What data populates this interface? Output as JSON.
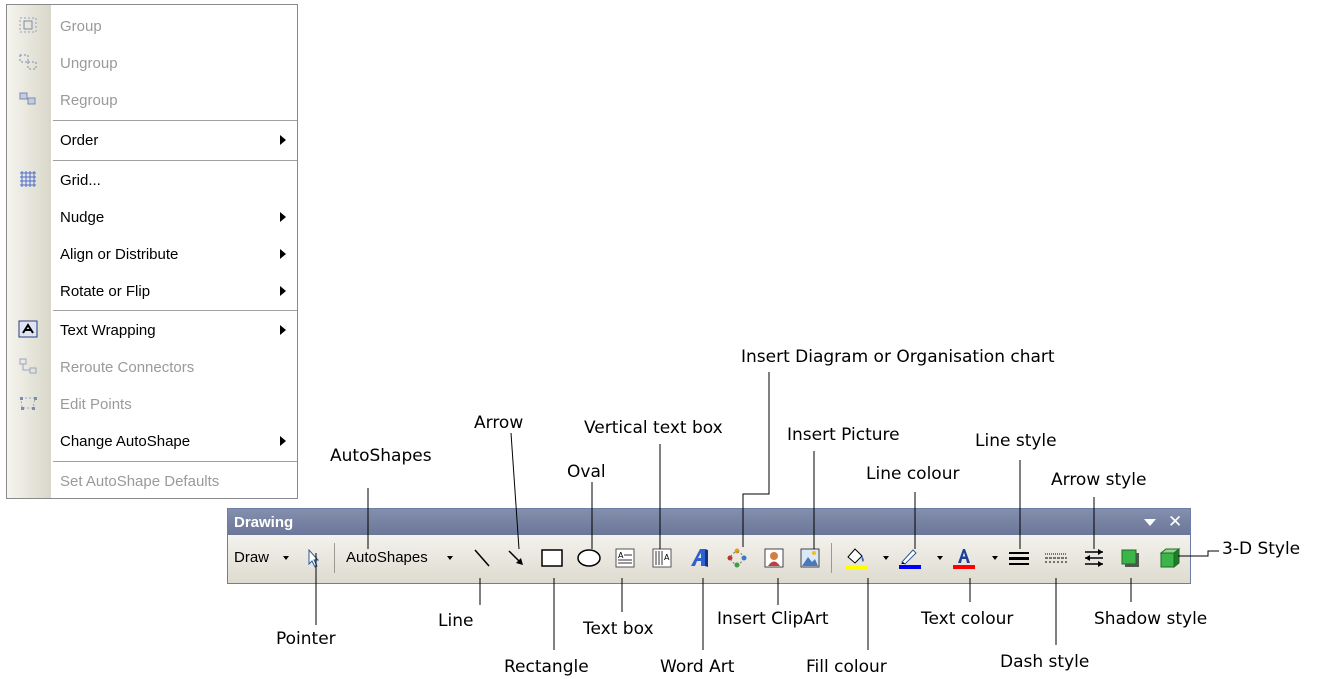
{
  "menu": {
    "items": [
      {
        "label": "Group",
        "disabled": true,
        "icon": "group-icon"
      },
      {
        "label": "Ungroup",
        "disabled": true,
        "icon": "ungroup-icon"
      },
      {
        "label": "Regroup",
        "disabled": true,
        "icon": "regroup-icon"
      },
      {
        "label": "Order",
        "submenu": true
      },
      {
        "label": "Grid...",
        "icon": "grid-icon"
      },
      {
        "label": "Nudge",
        "submenu": true
      },
      {
        "label": "Align or Distribute",
        "submenu": true
      },
      {
        "label": "Rotate or Flip",
        "submenu": true
      },
      {
        "label": "Text Wrapping",
        "submenu": true,
        "icon": "text-wrapping-icon"
      },
      {
        "label": "Reroute Connectors",
        "disabled": true,
        "icon": "reroute-connectors-icon"
      },
      {
        "label": "Edit Points",
        "disabled": true,
        "icon": "edit-points-icon"
      },
      {
        "label": "Change AutoShape",
        "submenu": true
      },
      {
        "label": "Set AutoShape Defaults",
        "disabled": true
      }
    ]
  },
  "toolbar": {
    "title": "Drawing",
    "draw_label": "Draw",
    "autoshapes_label": "AutoShapes",
    "fill_color": "#ffff00",
    "line_color": "#0000ff",
    "text_color": "#ff0000"
  },
  "callouts": {
    "pointer": "Pointer",
    "autoshapes": "AutoShapes",
    "line": "Line",
    "arrow": "Arrow",
    "rectangle": "Rectangle",
    "oval": "Oval",
    "text_box": "Text box",
    "vertical_text_box": "Vertical text box",
    "word_art": "Word Art",
    "insert_diagram": "Insert Diagram or Organisation chart",
    "insert_clipart": "Insert ClipArt",
    "insert_picture": "Insert Picture",
    "fill_colour": "Fill colour",
    "line_colour": "Line colour",
    "text_colour": "Text colour",
    "line_style": "Line style",
    "dash_style": "Dash style",
    "arrow_style": "Arrow style",
    "shadow_style": "Shadow style",
    "three_d_style": "3-D Style"
  }
}
